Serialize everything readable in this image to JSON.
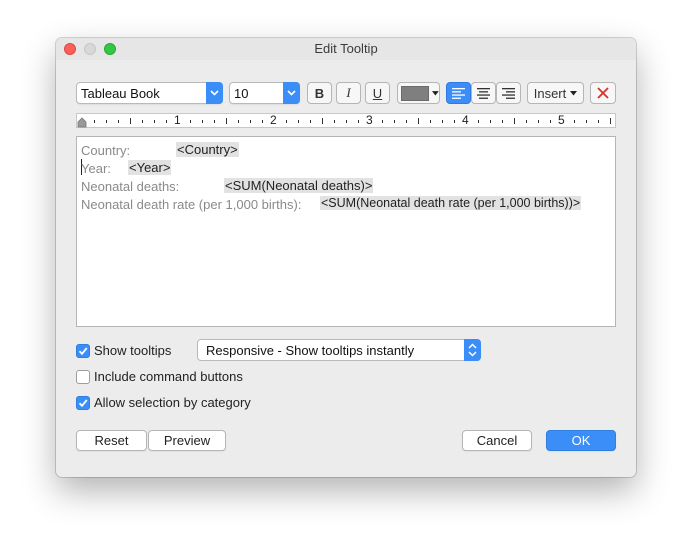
{
  "window": {
    "title": "Edit Tooltip"
  },
  "toolbar": {
    "font_family": "Tableau Book",
    "font_size": "10",
    "bold_label": "B",
    "italic_label": "I",
    "underline_label": "U",
    "text_color": "#7f7f7f",
    "insert_label": "Insert"
  },
  "ruler": {
    "numbers": [
      "1",
      "2",
      "3",
      "4",
      "5"
    ]
  },
  "editor": {
    "lines": [
      {
        "label": "Country:",
        "field": "<Country>"
      },
      {
        "label": "Year:",
        "field": "<Year>"
      },
      {
        "label": "Neonatal deaths:",
        "field": "<SUM(Neonatal deaths)>"
      },
      {
        "label": "Neonatal death rate (per 1,000 births):",
        "field": "<SUM(Neonatal death rate (per 1,000 births))>"
      }
    ]
  },
  "options": {
    "show_tooltips": {
      "label": "Show tooltips",
      "checked": true
    },
    "tooltip_mode": "Responsive - Show tooltips instantly",
    "include_command_buttons": {
      "label": "Include command buttons",
      "checked": false
    },
    "allow_selection": {
      "label": "Allow selection by category",
      "checked": true
    }
  },
  "buttons": {
    "reset": "Reset",
    "preview": "Preview",
    "cancel": "Cancel",
    "ok": "OK"
  },
  "colors": {
    "accent": "#3b8ef7",
    "field_bg": "#e2e2e2",
    "label_text": "#8a8a8a"
  }
}
